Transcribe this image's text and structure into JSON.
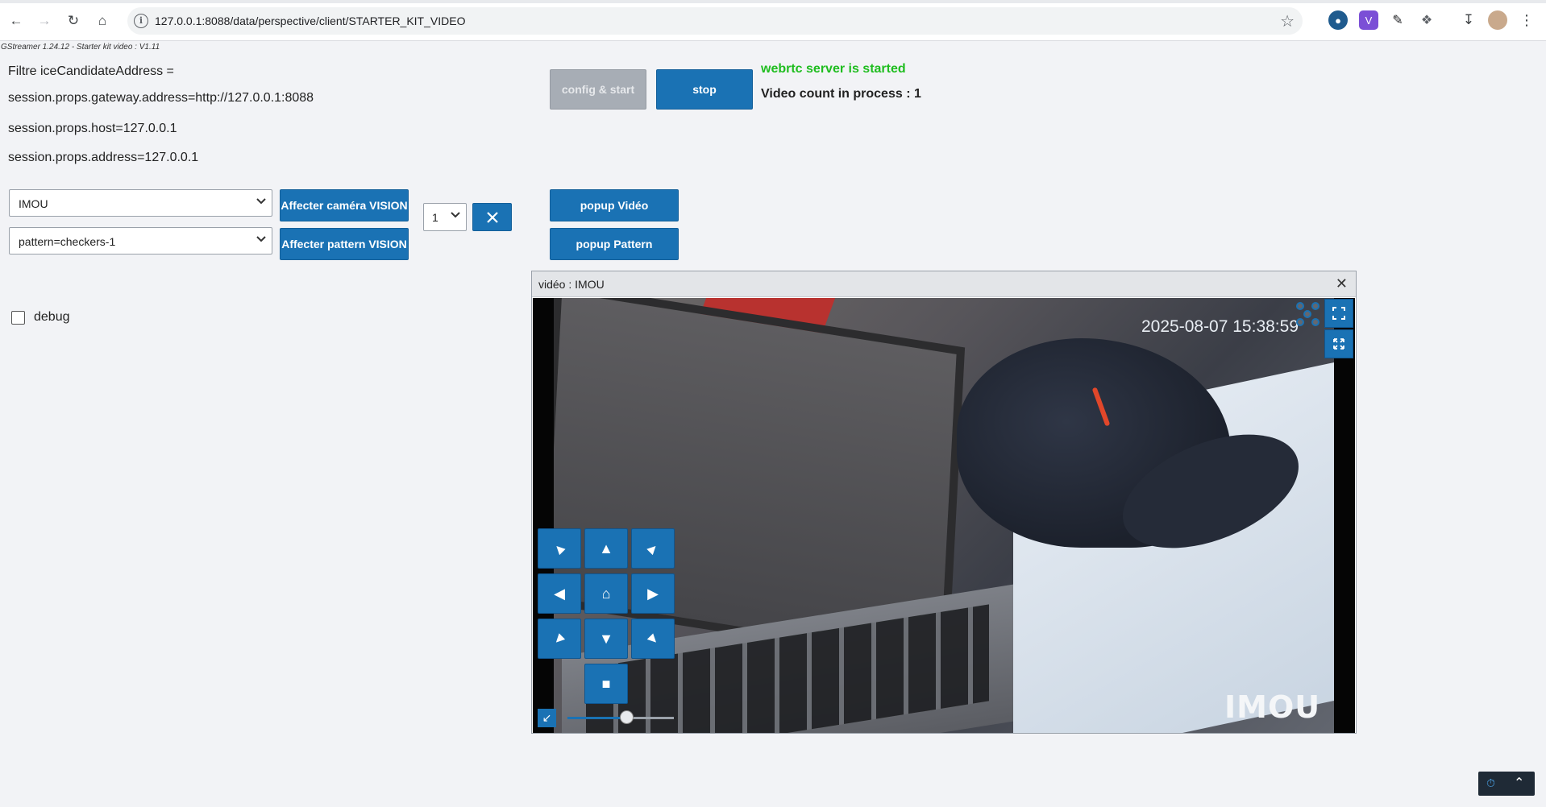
{
  "browser": {
    "url": "127.0.0.1:8088/data/perspective/client/STARTER_KIT_VIDEO"
  },
  "app": {
    "version": "GStreamer 1.24.12 - Starter kit video : V1.11",
    "filter_label": "Filtre iceCandidateAddress =",
    "gateway_address": "session.props.gateway.address=http://127.0.0.1:8088",
    "host": "session.props.host=127.0.0.1",
    "address": "session.props.address=127.0.0.1",
    "buttons": {
      "config_start": "config & start",
      "stop": "stop",
      "assign_camera": "Affecter caméra VISION",
      "assign_pattern": "Affecter pattern VISION",
      "popup_video": "popup Vidéo",
      "popup_pattern": "popup Pattern"
    },
    "status": {
      "server": "webrtc server is started",
      "count": "Video count in process : 1"
    },
    "camera_select": "IMOU",
    "pattern_select": "pattern=checkers-1",
    "index_select": "1",
    "debug_label": "debug",
    "debug_checked": false
  },
  "popup": {
    "title": "vidéo : IMOU",
    "timestamp": "2025-08-07 15:38:59",
    "logo": "IMOU",
    "zoom_level": 0.55
  },
  "colors": {
    "primary": "#1a72b4",
    "status_green": "#1fbd1f",
    "disabled": "#a7adb5"
  }
}
